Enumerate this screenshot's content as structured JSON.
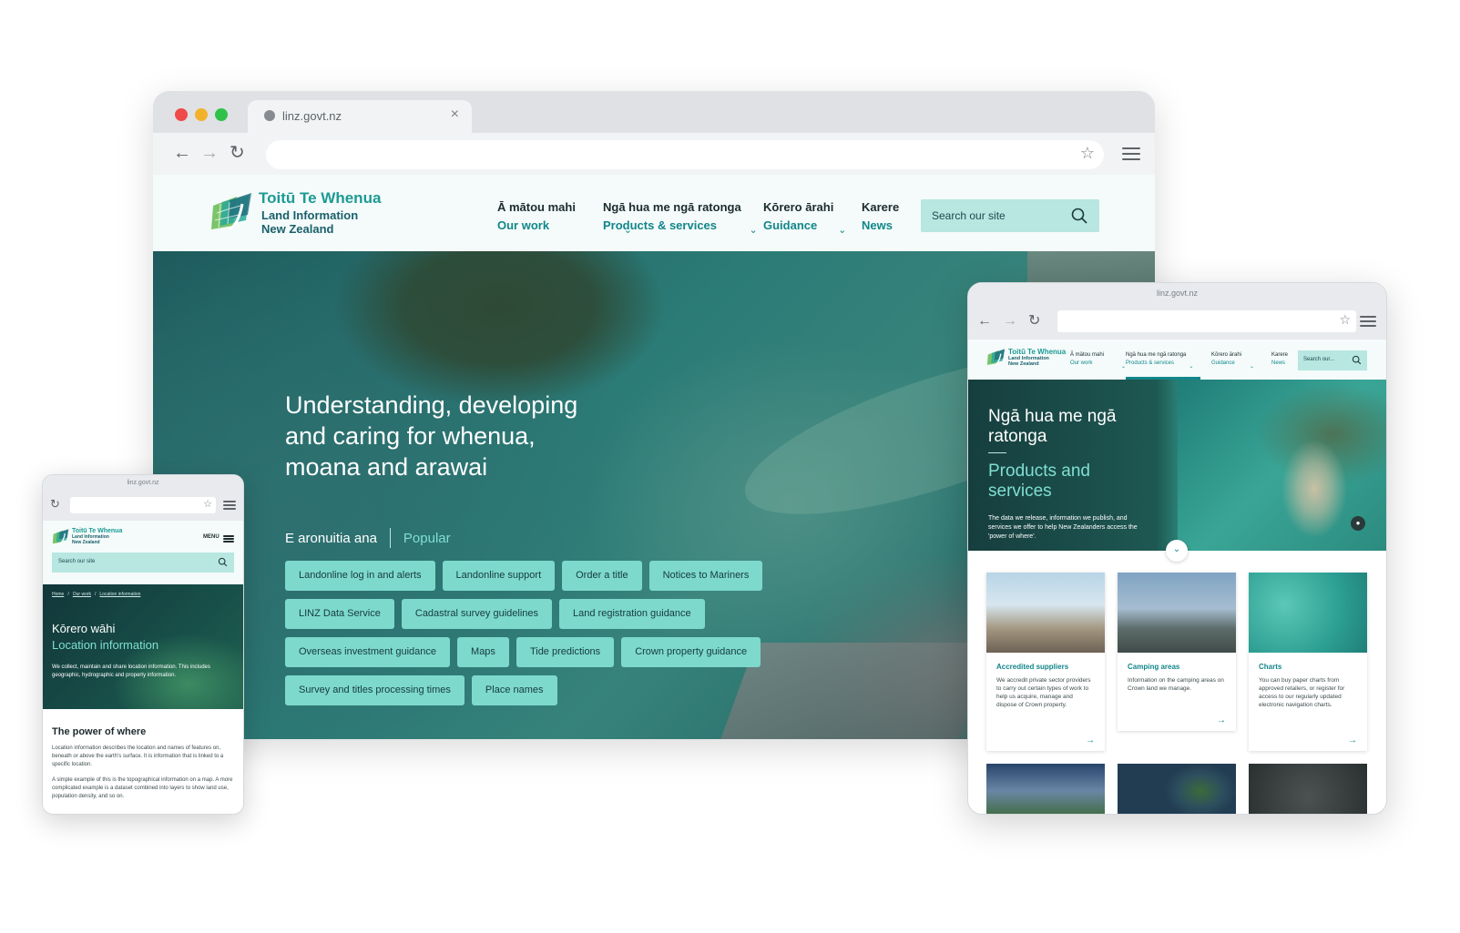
{
  "desktop": {
    "tab_title": "linz.govt.nz",
    "logo": {
      "line1": "Toitū Te Whenua",
      "line2": "Land Information",
      "line3": "New Zealand"
    },
    "nav": [
      {
        "mi": "Ā mātou mahi",
        "en": "Our work"
      },
      {
        "mi": "Ngā hua me ngā ratonga",
        "en": "Products & services"
      },
      {
        "mi": "Kōrero ārahi",
        "en": "Guidance"
      },
      {
        "mi": "Karere",
        "en": "News"
      }
    ],
    "search_placeholder": "Search our site",
    "hero_title": "Understanding, developing and caring for whenua, moana and arawai",
    "popular_mi": "E aronuitia ana",
    "popular_en": "Popular",
    "chips": [
      "Landonline log in and alerts",
      "Landonline support",
      "Order a title",
      "Notices to Mariners",
      "LINZ Data Service",
      "Cadastral survey guidelines",
      "Land registration guidance",
      "Overseas investment guidance",
      "Maps",
      "Tide predictions",
      "Crown property guidance",
      "Survey and titles processing times",
      "Place names"
    ]
  },
  "tablet": {
    "url": "linz.govt.nz",
    "logo": {
      "line1": "Toitū Te Whenua",
      "line2": "Land Information",
      "line3": "New Zealand"
    },
    "nav": [
      {
        "mi": "Ā mātou mahi",
        "en": "Our work"
      },
      {
        "mi": "Ngā hua me ngā ratonga",
        "en": "Products & services"
      },
      {
        "mi": "Kōrero ārahi",
        "en": "Guidance"
      },
      {
        "mi": "Karere",
        "en": "News"
      }
    ],
    "search_placeholder": "Search our...",
    "hero_mi": "Ngā hua me ngā ratonga",
    "hero_en": "Products and services",
    "hero_desc": "The data we release, information we publish, and services we offer to help New Zealanders access the 'power of where'.",
    "cards": [
      {
        "title": "Accredited suppliers",
        "text": "We accredit private sector providers to carry out certain types of work to help us acquire, manage and dispose of Crown property."
      },
      {
        "title": "Camping areas",
        "text": "Information on the camping areas on Crown land we manage."
      },
      {
        "title": "Charts",
        "text": "You can buy paper charts from approved retailers, or register for access to our regularly updated electronic navigation charts."
      }
    ]
  },
  "mobile": {
    "url": "linz.govt.nz",
    "logo": {
      "line1": "Toitū Te Whenua",
      "line2": "Land Information",
      "line3": "New Zealand"
    },
    "menu_label": "MENU",
    "search_placeholder": "Search our site",
    "breadcrumbs": [
      "Home",
      "Our work",
      "Location information"
    ],
    "hero_mi": "Kōrero wāhi",
    "hero_en": "Location information",
    "hero_desc": "We collect, maintain and share location information. This includes geographic, hydrographic and property information.",
    "section_title": "The power of where",
    "para1": "Location information describes the location and names of features on, beneath or above the earth's surface. It is information that is linked to a specific location.",
    "para2": "A simple example of this is the topographical information on a map. A more complicated example is a dataset combined into layers to show land use, population density, and so on."
  }
}
